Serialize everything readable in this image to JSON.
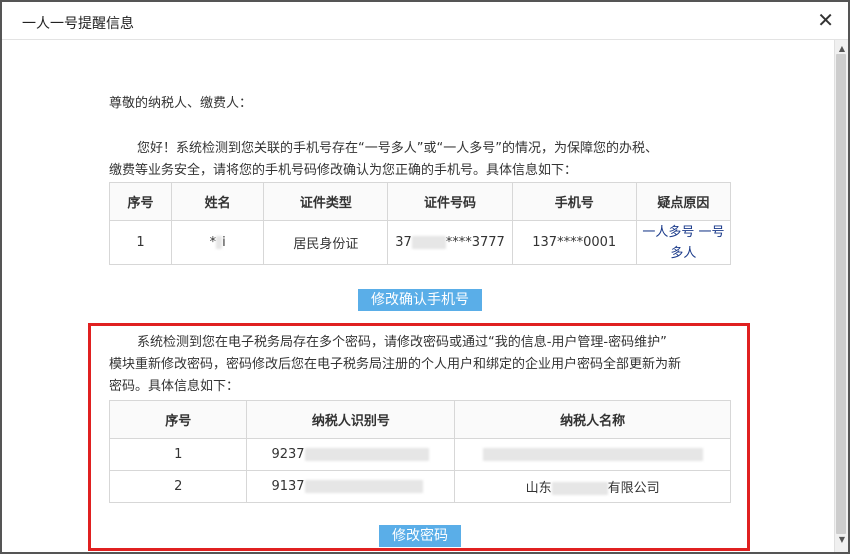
{
  "dialog": {
    "title": "一人一号提醒信息",
    "close_glyph": "✕"
  },
  "notice": {
    "greeting": "尊敬的纳税人、缴费人：",
    "line1": "您好！系统检测到您关联的手机号存在“一号多人”或“一人多号”的情况，为保障您的办税、",
    "line2": "缴费等业务安全，请将您的手机号码修改确认为您正确的手机号。具体信息如下："
  },
  "phone_table": {
    "headers": [
      "序号",
      "姓名",
      "证件类型",
      "证件号码",
      "手机号",
      "疑点原因"
    ],
    "rows": [
      {
        "index": "1",
        "name": "*",
        "name_tail": "i",
        "id_type": "居民身份证",
        "id_prefix": "37",
        "id_suffix": "****3777",
        "phone": "137****0001",
        "reason_line1": "一人多号 一号",
        "reason_line2": "多人"
      }
    ]
  },
  "confirm_button": "修改确认手机号",
  "password_notice": {
    "line1": "系统检测到您在电子税务局存在多个密码，请修改密码或通过“我的信息-用户管理-密码维护”",
    "line2": "模块重新修改密码，密码修改后您在电子税务局注册的个人用户和绑定的企业用户密码全部更新为新",
    "line3": "密码。具体信息如下："
  },
  "tax_table": {
    "headers": [
      "序号",
      "纳税人识别号",
      "纳税人名称"
    ],
    "rows": [
      {
        "index": "1",
        "id_prefix": "9237",
        "name_prefix": "",
        "name_suffix": ""
      },
      {
        "index": "2",
        "id_prefix": "9137",
        "name_prefix": "山东",
        "name_suffix": "有限公司"
      }
    ]
  },
  "password_button": "修改密码",
  "colors": {
    "button": "#5aaee8",
    "highlight": "#e02020",
    "reason_text": "#1a3a8a"
  }
}
